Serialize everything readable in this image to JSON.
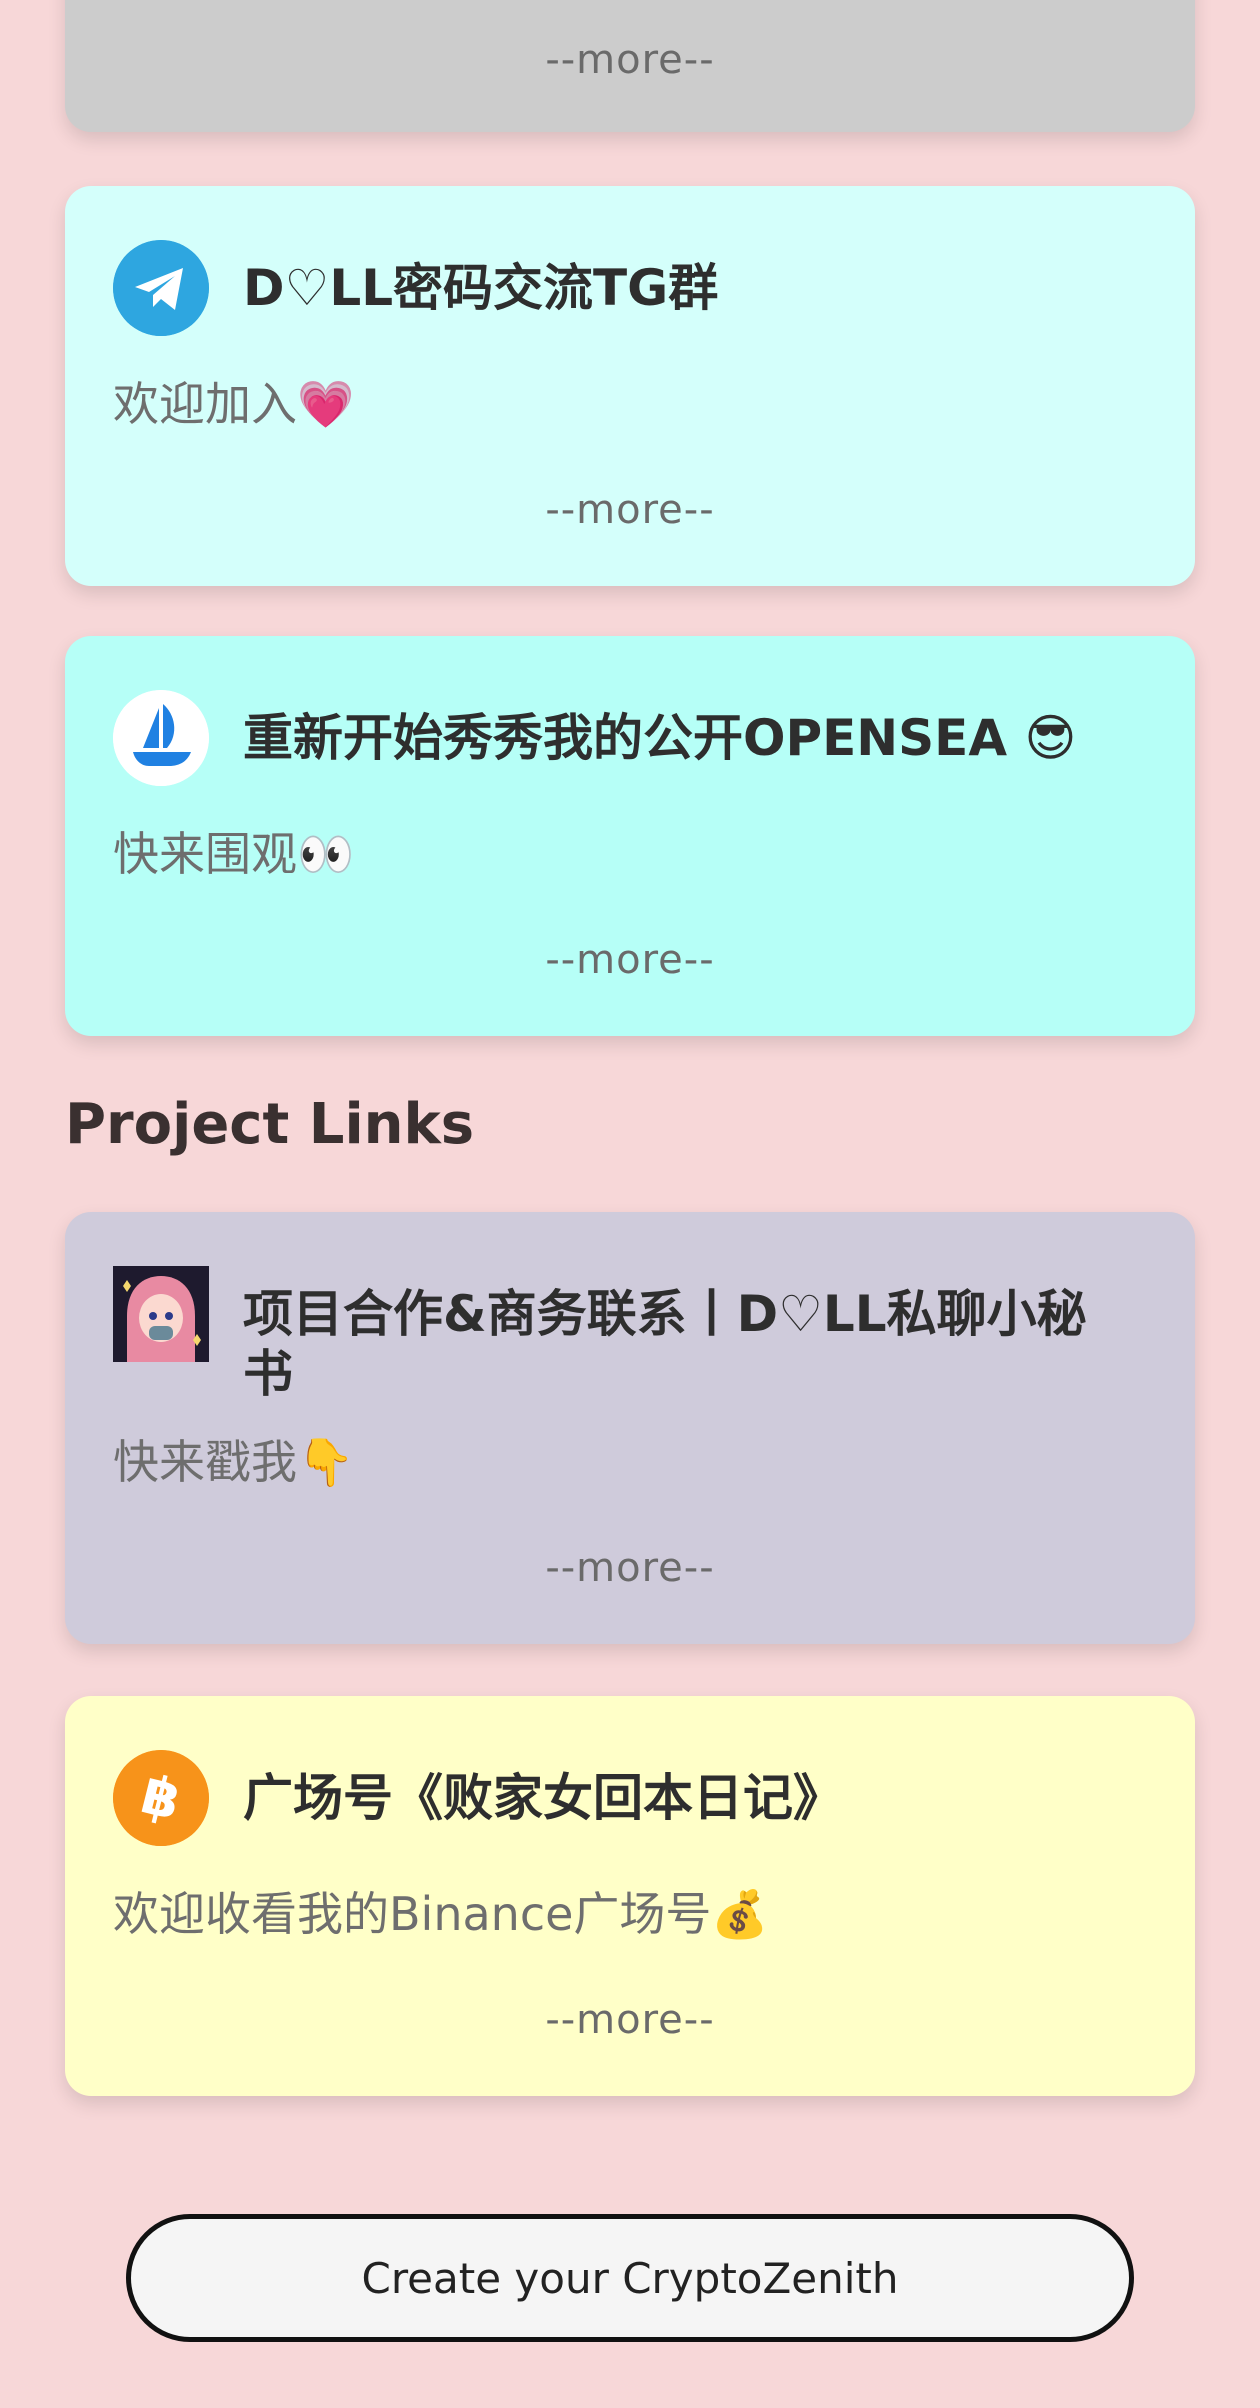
{
  "cards": [
    {
      "more": "--more--"
    },
    {
      "title": "D♡LL密码交流TG群",
      "desc": "欢迎加入💗",
      "more": "--more--",
      "icon": "telegram-icon",
      "bg": "#d4fffb"
    },
    {
      "title": "重新开始秀秀我的公开OPENSEA 😎",
      "desc": "快来围观👀",
      "more": "--more--",
      "icon": "opensea-icon",
      "bg": "#b6fff7"
    }
  ],
  "section": {
    "title": "Project Links"
  },
  "project_cards": [
    {
      "title": "项目合作&商务联系丨D♡LL私聊小秘书",
      "desc": "快来戳我👇",
      "more": "--more--",
      "icon": "avatar-image",
      "bg": "#cfcbdb"
    },
    {
      "title": "广场号《败家女回本日记》",
      "desc": "欢迎收看我的Binance广场号💰",
      "more": "--more--",
      "icon": "bitcoin-icon",
      "bg": "#ffffc8"
    }
  ],
  "cta": {
    "label": "Create your CryptoZenith"
  },
  "colors": {
    "page_bg": "#f7d7d8",
    "gray_card": "#cccccc",
    "telegram": "#2ea6e0",
    "opensea": "#2081e2",
    "bitcoin": "#f7931a"
  }
}
